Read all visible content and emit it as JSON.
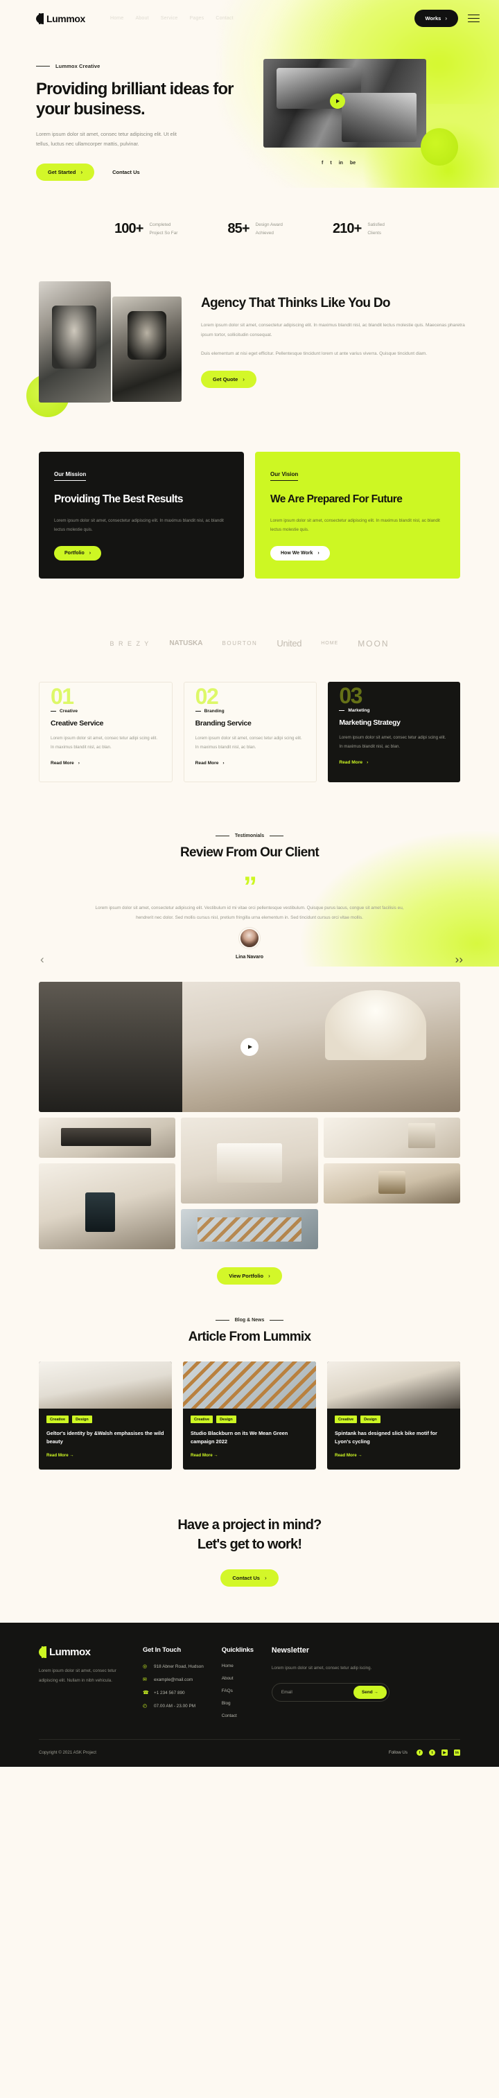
{
  "brand": {
    "name": "Lummox",
    "accent": "#cdf723",
    "dark": "#141412",
    "bg": "#fdf9f2"
  },
  "nav": {
    "links": [
      "Home",
      "About",
      "Service",
      "Pages",
      "Contact"
    ],
    "works_label": "Works",
    "chevron": "›"
  },
  "hero": {
    "eyebrow": "Lummox Creative",
    "title": "Providing brilliant ideas for your business.",
    "subtitle": "Lorem ipsum dolor sit amet, consec tetur adipiscing elit. Ut elit tellus, luctus nec ullamcorper mattis, pulvinar.",
    "primary_cta": "Get Started",
    "secondary_cta": "Contact Us",
    "socials": [
      "f",
      "t",
      "in",
      "be"
    ]
  },
  "stats": [
    {
      "number": "100+",
      "label_l1": "Completed",
      "label_l2": "Project So Far"
    },
    {
      "number": "85+",
      "label_l1": "Design Award",
      "label_l2": "Achieved"
    },
    {
      "number": "210+",
      "label_l1": "Satisfied",
      "label_l2": "Clients"
    }
  ],
  "agency": {
    "title": "Agency That Thinks Like You Do",
    "p1": "Lorem ipsum dolor sit amet, consectetur adipiscing elit. In maximus blandit nisl, ac blandit lectus molestie quis. Maecenas pharetra ipsum tortor, sollicitudin consequat.",
    "p2": "Duis elementum at nisi eget efficitur. Pellentesque tincidunt lorem ut ante varius viverra. Quisque tincidunt diam.",
    "cta": "Get Quote"
  },
  "mission": {
    "kicker": "Our Mission",
    "title": "Providing The Best Results",
    "body": "Lorem ipsum dolor sit amet, consectetur adipiscing elit. In maximus blandit nisl, ac blandit lectus molestie quis.",
    "cta": "Portfolio"
  },
  "vision": {
    "kicker": "Our Vision",
    "title": "We Are Prepared For Future",
    "body": "Lorem ipsum dolor sit amet, consectetur adipiscing elit. In maximus blandit nisl, ac blandit lectus molestie quis.",
    "cta": "How We Work"
  },
  "brands": [
    "B R E Z Y",
    "NATUSKA",
    "BOURTON",
    "United",
    "HOME",
    "MOON"
  ],
  "services": [
    {
      "num": "01",
      "tag": "Creative",
      "title": "Creative Service",
      "body": "Lorem ipsum dolor sit amet, consec tetur adipi scing elit. In maximus blandit nisl, ac blan.",
      "more": "Read More"
    },
    {
      "num": "02",
      "tag": "Branding",
      "title": "Branding Service",
      "body": "Lorem ipsum dolor sit amet, consec tetur adipi scing elit. In maximus blandit nisl, ac blan.",
      "more": "Read More"
    },
    {
      "num": "03",
      "tag": "Marketing",
      "title": "Marketing Strategy",
      "body": "Lorem ipsum dolor sit amet, consec tetur adipi scing elit. In maximus blandit nisl, ac blan.",
      "more": "Read More"
    }
  ],
  "testimonials": {
    "kicker": "Testimonials",
    "title": "Review From Our Client",
    "quote_glyph": "”",
    "body": "Lorem ipsum dolor sit amet, consectetur adipiscing elit. Vestibulum id mi vitae orci pellentesque vestibulum. Quisque purus lacus, congue sit amet facilisis eu, hendrerit nec dolor. Sed mollis cursus nisl, pretium fringilla urna elementum in. Sed tincidunt cursus orci vitae mollis.",
    "author": "Lina Navaro",
    "prev": "‹",
    "next": "››"
  },
  "gallery": {
    "cta": "View Portfolio"
  },
  "blog": {
    "kicker": "Blog & News",
    "title": "Article From Lummix",
    "posts": [
      {
        "tags": [
          "Creative",
          "Design"
        ],
        "title": "Geltor's identity by &Walsh emphasises the wild beauty",
        "more": "Read More →"
      },
      {
        "tags": [
          "Creative",
          "Design"
        ],
        "title": "Studio Blackburn on its We Mean Green campaign 2022",
        "more": "Read More →"
      },
      {
        "tags": [
          "Creative",
          "Design"
        ],
        "title": "Spintank has designed slick bike motif for Lyon's cycling",
        "more": "Read More →"
      }
    ]
  },
  "cta": {
    "line1": "Have a project in mind?",
    "line2": "Let's get to work!",
    "button": "Contact Us"
  },
  "footer": {
    "logo": "Lummox",
    "about": "Lorem ipsum dolor sit amet, consec tetur adipiscing elit. Nullam in nibh vehicula.",
    "contact_title": "Get In Touch",
    "contact": [
      {
        "icon": "◎",
        "text": "918 Abner Road, Hudson"
      },
      {
        "icon": "✉",
        "text": "example@mail.com"
      },
      {
        "icon": "☎",
        "text": "+1 234 567 890"
      },
      {
        "icon": "◴",
        "text": "07.00 AM - 23.00 PM"
      }
    ],
    "quicklinks_title": "Quicklinks",
    "quicklinks": [
      "Home",
      "About",
      "FAQs",
      "Blog",
      "Contact"
    ],
    "newsletter_title": "Newsletter",
    "newsletter_body": "Lorem ipsum dolor sit amet, consec tetur adip iscing.",
    "email_placeholder": "Email",
    "send_label": "Send →",
    "copyright": "Copyright © 2021 ASK Project",
    "follow_label": "Follow Us",
    "social": [
      "f",
      "t",
      "▶",
      "in"
    ]
  }
}
